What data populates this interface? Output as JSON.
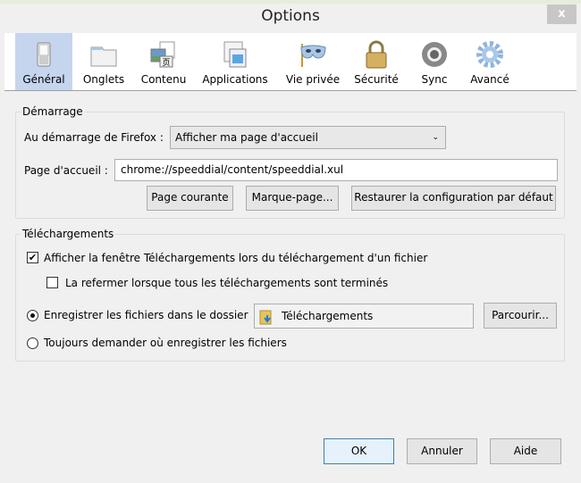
{
  "window": {
    "title": "Options",
    "close": "x"
  },
  "panes": [
    {
      "label": "Général",
      "icon": "switch-icon",
      "selected": true
    },
    {
      "label": "Onglets",
      "icon": "tabs-folder-icon"
    },
    {
      "label": "Contenu",
      "icon": "content-icon"
    },
    {
      "label": "Applications",
      "icon": "applications-icon"
    },
    {
      "label": "Vie privée",
      "icon": "mask-icon"
    },
    {
      "label": "Sécurité",
      "icon": "padlock-icon"
    },
    {
      "label": "Sync",
      "icon": "sync-icon"
    },
    {
      "label": "Avancé",
      "icon": "gear-icon"
    }
  ],
  "startup": {
    "legend": "Démarrage",
    "when_label": "Au démarrage de Firefox :",
    "when_value": "Afficher ma page d'accueil",
    "home_label": "Page d'accueil :",
    "home_value": "chrome://speeddial/content/speeddial.xul",
    "btn_current": "Page courante",
    "btn_bookmark": "Marque-page...",
    "btn_restore": "Restaurer la configuration par défaut"
  },
  "downloads": {
    "legend": "Téléchargements",
    "show_window": "Afficher la fenêtre Téléchargements lors du téléchargement d'un fichier",
    "show_window_checked": true,
    "close_when_done": "La refermer lorsque tous les téléchargements sont terminés",
    "close_when_done_checked": false,
    "save_to": "Enregistrer les fichiers dans le dossier",
    "folder": "Téléchargements",
    "browse": "Parcourir...",
    "always_ask": "Toujours demander où enregistrer les fichiers",
    "selected": "save_to"
  },
  "footer": {
    "ok": "OK",
    "cancel": "Annuler",
    "help": "Aide"
  }
}
